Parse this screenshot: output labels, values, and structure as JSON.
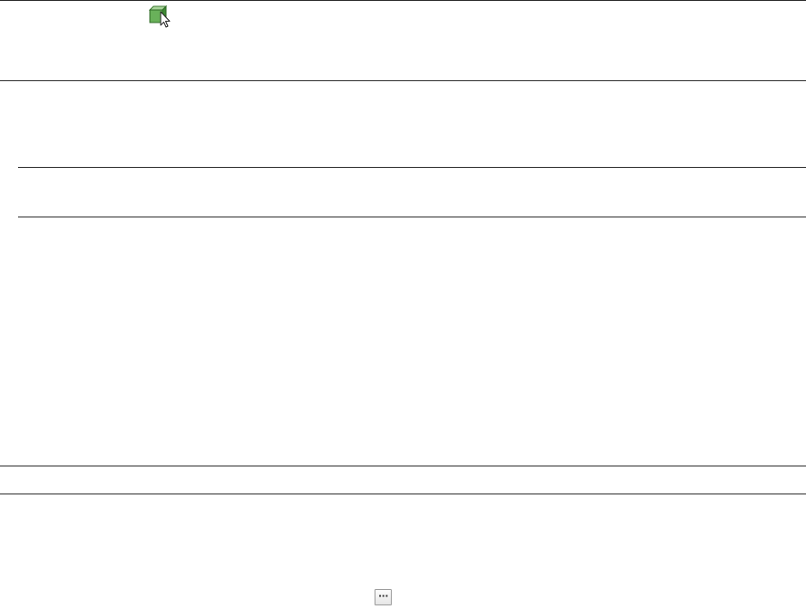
{
  "icons": {
    "select_object": "select-object-icon",
    "browse": "ellipsis-icon"
  },
  "browse_button": {
    "label": "···"
  },
  "colors": {
    "divider": "#2b2b2b",
    "icon_green": "#5aa14a",
    "button_border": "#9a9a9a"
  }
}
